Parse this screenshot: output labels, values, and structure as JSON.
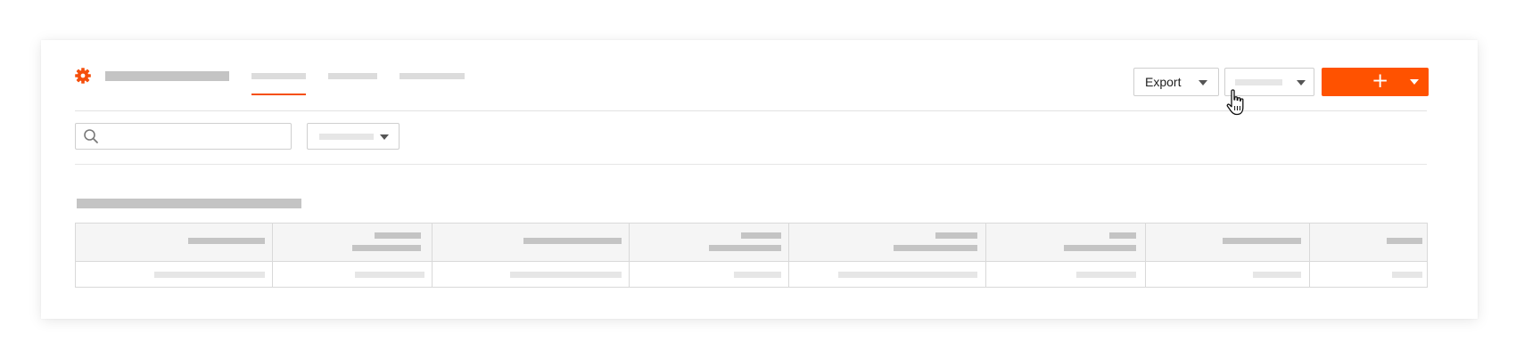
{
  "header": {
    "logo_icon": "gear-icon",
    "brand_color": "#f54f0c",
    "export_button": {
      "label": "Export",
      "icon": "chevron-down-icon"
    },
    "select_button": {
      "icon": "chevron-down-icon"
    },
    "create_button": {
      "label": "+",
      "icon": "chevron-down-icon",
      "color": "#ff5200"
    }
  },
  "filters": {
    "search": {
      "icon": "search-icon",
      "placeholder": ""
    },
    "filter_dropdown": {
      "icon": "chevron-down-icon"
    }
  },
  "table": {
    "column_count": 8,
    "row_count": 1
  },
  "cursor": {
    "icon": "hand-pointer-icon"
  }
}
